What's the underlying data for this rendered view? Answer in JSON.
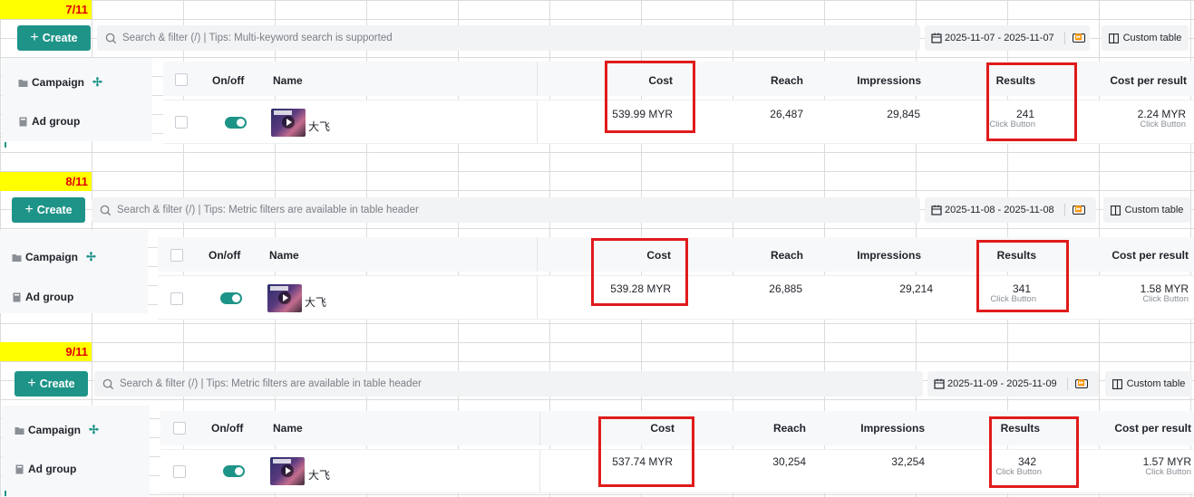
{
  "colors": {
    "accent": "#1e9488",
    "highlight": "#e01b1b",
    "day_label_bg": "#ffff00",
    "day_label_text": "#e00000"
  },
  "toolbar": {
    "create_label": "Create",
    "custom_table_label": "Custom table",
    "timezone_badge": "⏩"
  },
  "sidebar": {
    "campaign_label": "Campaign",
    "ad_group_label": "Ad group"
  },
  "columns": {
    "onoff": "On/off",
    "name": "Name",
    "cost": "Cost",
    "reach": "Reach",
    "impressions": "Impressions",
    "results": "Results",
    "cost_per_result": "Cost per result"
  },
  "snapshots": [
    {
      "day_label": "7/11",
      "search_placeholder": "Search & filter (/) | Tips: Multi-keyword search is supported",
      "date_range": "2025-11-07 - 2025-11-07",
      "row": {
        "name": "大飞",
        "cost": "539.99 MYR",
        "reach": "26,487",
        "impressions": "29,845",
        "results": "241",
        "results_sub": "Click Button",
        "cost_per_result": "2.24 MYR",
        "cpr_sub": "Click Button"
      }
    },
    {
      "day_label": "8/11",
      "search_placeholder": "Search & filter (/) | Tips: Metric filters are available in table header",
      "date_range": "2025-11-08 - 2025-11-08",
      "row": {
        "name": "大飞",
        "cost": "539.28 MYR",
        "reach": "26,885",
        "impressions": "29,214",
        "results": "341",
        "results_sub": "Click Button",
        "cost_per_result": "1.58 MYR",
        "cpr_sub": "Click Button"
      }
    },
    {
      "day_label": "9/11",
      "search_placeholder": "Search & filter (/) | Tips: Metric filters are available in table header",
      "date_range": "2025-11-09 - 2025-11-09",
      "row": {
        "name": "大飞",
        "cost": "537.74 MYR",
        "reach": "30,254",
        "impressions": "32,254",
        "results": "342",
        "results_sub": "Click Button",
        "cost_per_result": "1.57 MYR",
        "cpr_sub": "Click Button"
      }
    }
  ]
}
